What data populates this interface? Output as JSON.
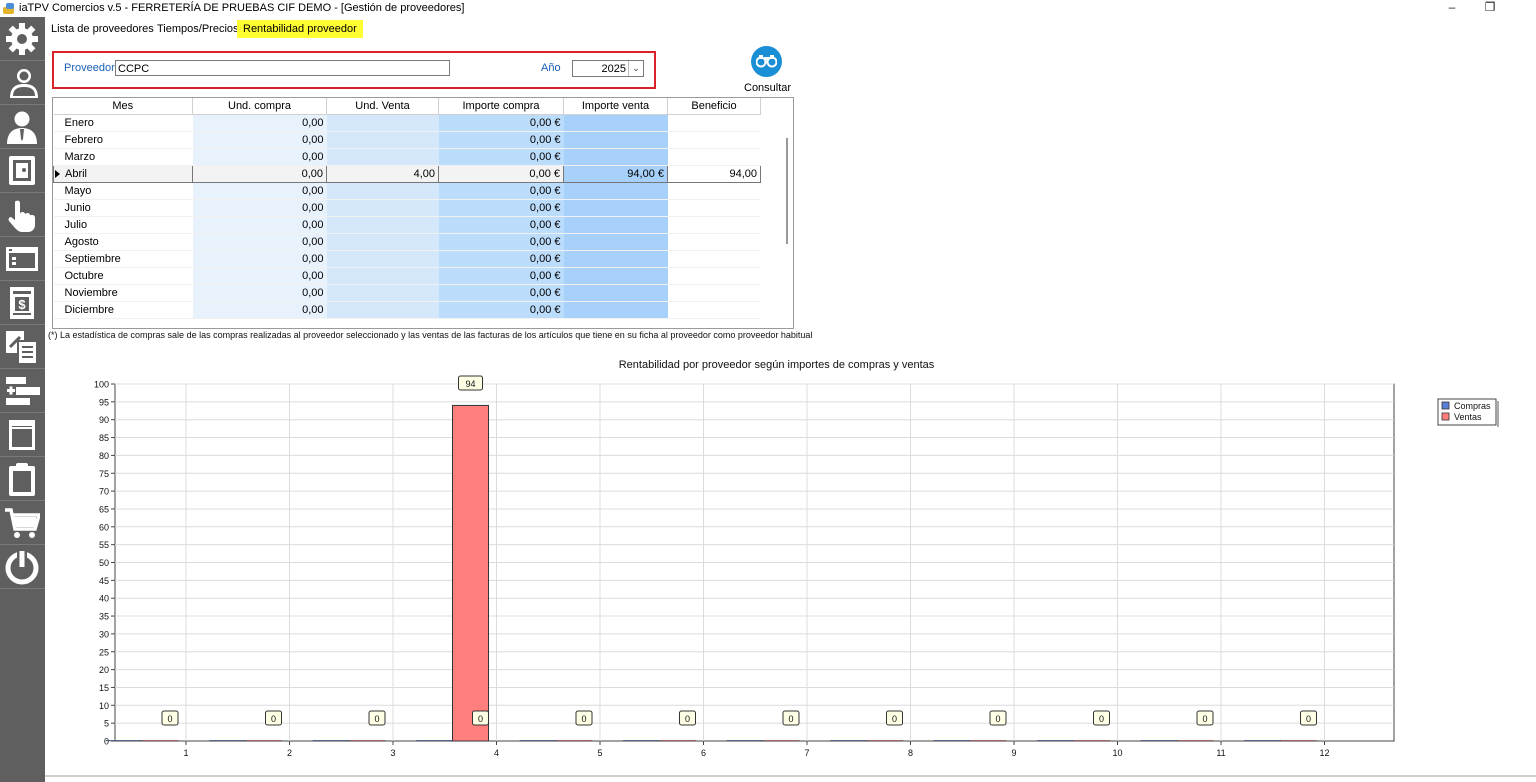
{
  "window": {
    "title": "iaTPV Comercios v.5 - FERRETERÍA DE PRUEBAS CIF DEMO - [Gestión de proveedores]",
    "minimize_glyph": "–",
    "restore_glyph": "❐"
  },
  "sidebar": {
    "items": [
      {
        "icon": "gear-icon"
      },
      {
        "icon": "users-icon"
      },
      {
        "icon": "person-icon"
      },
      {
        "icon": "safe-icon"
      },
      {
        "icon": "hand-pointer-icon"
      },
      {
        "icon": "window-icon"
      },
      {
        "icon": "invoice-icon"
      },
      {
        "icon": "documents-icon"
      },
      {
        "icon": "add-minus-icon"
      },
      {
        "icon": "panel-icon"
      },
      {
        "icon": "clipboard-icon"
      },
      {
        "icon": "cart-icon"
      },
      {
        "icon": "power-icon"
      }
    ]
  },
  "tabs": [
    {
      "label": "Lista de proveedores",
      "active": false
    },
    {
      "label": "Tiempos/Precios",
      "active": false
    },
    {
      "label": "Rentabilidad proveedor",
      "active": true
    }
  ],
  "filter": {
    "proveedor_label": "Proveedor",
    "proveedor_value": "CCPC",
    "anio_label": "Año",
    "anio_value": "2025"
  },
  "consultar_label": "Consultar",
  "grid": {
    "columns": [
      "Mes",
      "Und. compra",
      "Und. Venta",
      "Importe compra",
      "Importe venta",
      "Beneficio"
    ],
    "rows": [
      [
        "Enero",
        "0,00",
        "",
        "0,00 €",
        "",
        ""
      ],
      [
        "Febrero",
        "0,00",
        "",
        "0,00 €",
        "",
        ""
      ],
      [
        "Marzo",
        "0,00",
        "",
        "0,00 €",
        "",
        ""
      ],
      [
        "Abril",
        "0,00",
        "4,00",
        "0,00 €",
        "94,00 €",
        "94,00"
      ],
      [
        "Mayo",
        "0,00",
        "",
        "0,00 €",
        "",
        ""
      ],
      [
        "Junio",
        "0,00",
        "",
        "0,00 €",
        "",
        ""
      ],
      [
        "Julio",
        "0,00",
        "",
        "0,00 €",
        "",
        ""
      ],
      [
        "Agosto",
        "0,00",
        "",
        "0,00 €",
        "",
        ""
      ],
      [
        "Septiembre",
        "0,00",
        "",
        "0,00 €",
        "",
        ""
      ],
      [
        "Octubre",
        "0,00",
        "",
        "0,00 €",
        "",
        ""
      ],
      [
        "Noviembre",
        "0,00",
        "",
        "0,00 €",
        "",
        ""
      ],
      [
        "Diciembre",
        "0,00",
        "",
        "0,00 €",
        "",
        ""
      ]
    ],
    "selected_row": 3
  },
  "note": "(*) La estadística de compras sale de las compras realizadas al proveedor seleccionado y las ventas de las facturas de los artículos que tiene en su ficha al proveedor como proveedor habitual",
  "chart_data": {
    "type": "bar",
    "title": "Rentabilidad por proveedor según importes de compras y ventas",
    "categories": [
      "1",
      "2",
      "3",
      "4",
      "5",
      "6",
      "7",
      "8",
      "9",
      "10",
      "11",
      "12"
    ],
    "series": [
      {
        "name": "Compras",
        "values": [
          0,
          0,
          0,
          0,
          0,
          0,
          0,
          0,
          0,
          0,
          0,
          0
        ],
        "color": "#5b7fd6"
      },
      {
        "name": "Ventas",
        "values": [
          0,
          0,
          0,
          94,
          0,
          0,
          0,
          0,
          0,
          0,
          0,
          0
        ],
        "color": "#ff7f7f"
      }
    ],
    "data_labels": [
      "0",
      "0",
      "0",
      "0",
      "0",
      "0",
      "0",
      "0",
      "0",
      "0",
      "0",
      "0"
    ],
    "bar_label": "94",
    "ylim": [
      0,
      100
    ],
    "ytick_step": 5,
    "grid": true,
    "legend": "top-right"
  }
}
